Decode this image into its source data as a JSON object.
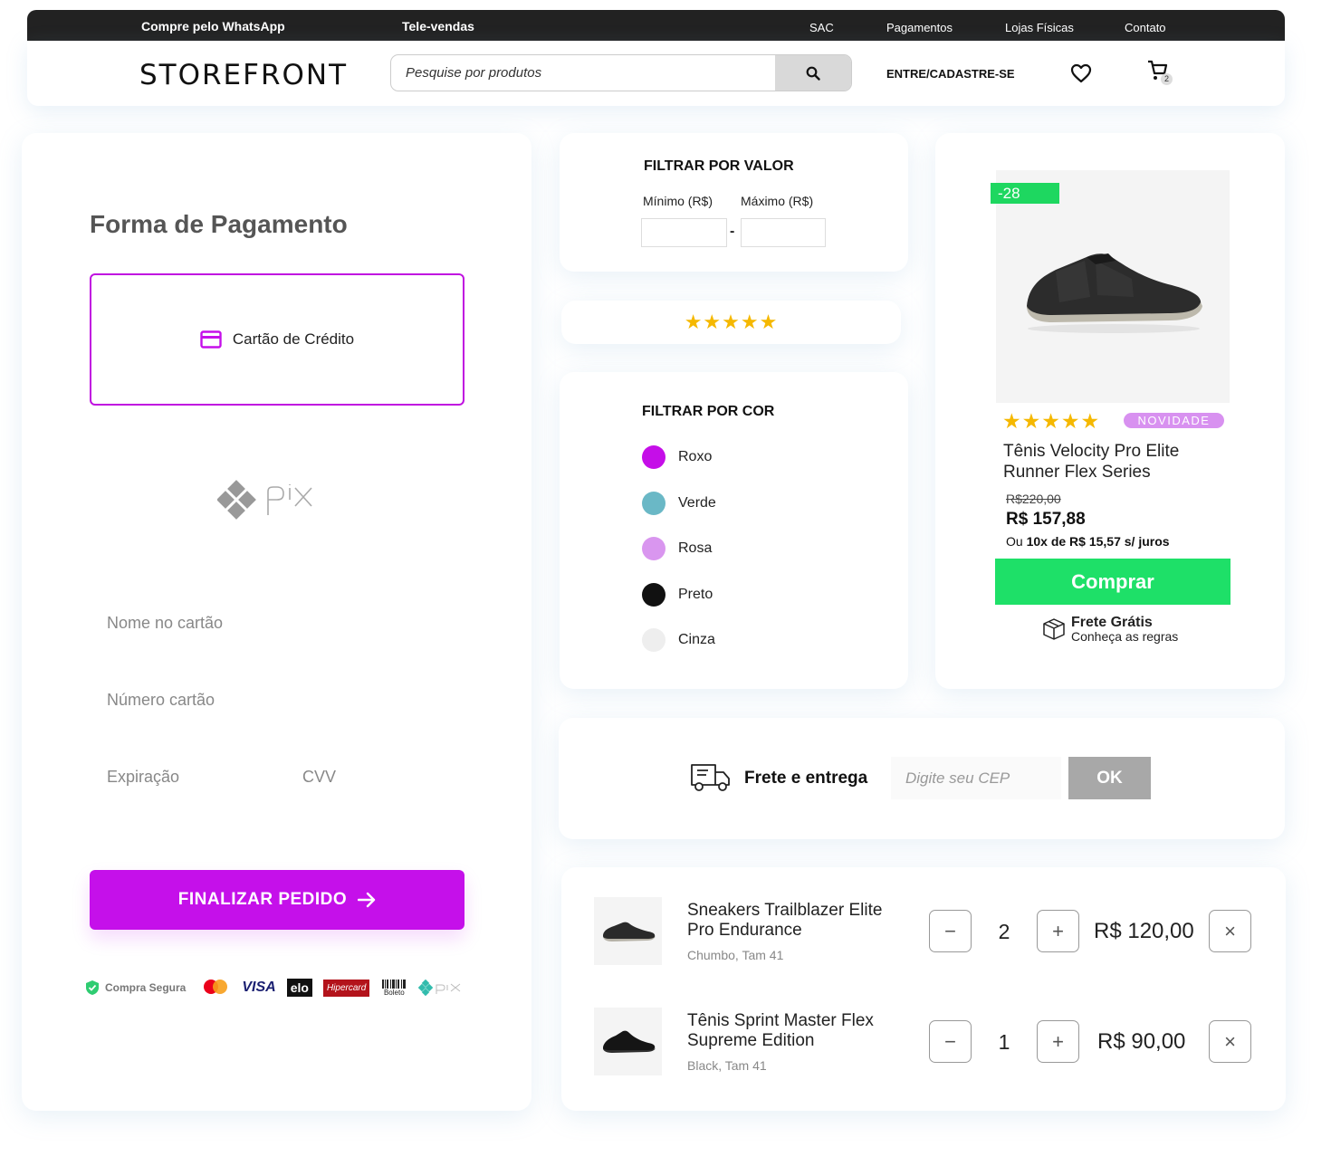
{
  "topbar": {
    "whatsapp": "Compre pelo WhatsApp",
    "televendas": "Tele-vendas",
    "links": [
      "SAC",
      "Pagamentos",
      "Lojas Físicas",
      "Contato"
    ]
  },
  "header": {
    "logo": "STOREFRONT",
    "search_placeholder": "Pesquise por produtos",
    "login": "ENTRE/CADASTRE-SE",
    "cart_count": "2"
  },
  "payment": {
    "title": "Forma de Pagamento",
    "credit_option": "Cartão de Crédito",
    "pix_label": "pix",
    "fields": {
      "name": "Nome no cartão",
      "number": "Número cartão",
      "expiry": "Expiração",
      "cvv": "CVV"
    },
    "finish": "FINALIZAR PEDIDO",
    "secure": "Compra Segura",
    "logos": [
      "VISA",
      "elo",
      "Hipercard",
      "Boleto"
    ]
  },
  "filter_value": {
    "title": "FILTRAR POR VALOR",
    "min_label": "Mínimo (R$)",
    "max_label": "Máximo (R$)",
    "separator": "-"
  },
  "rating_filter": {
    "stars": "★★★★★"
  },
  "filter_color": {
    "title": "FILTRAR POR COR",
    "colors": [
      {
        "name": "Roxo",
        "hex": "#c50ee8"
      },
      {
        "name": "Verde",
        "hex": "#6ab8c6"
      },
      {
        "name": "Rosa",
        "hex": "#d996ef"
      },
      {
        "name": "Preto",
        "hex": "#111111"
      },
      {
        "name": "Cinza",
        "hex": "#eeeeee"
      }
    ]
  },
  "product": {
    "discount": "-28",
    "stars": "★★★★★",
    "badge": "NOVIDADE",
    "name": "Tênis Velocity Pro Elite Runner Flex Series",
    "old_price": "R$220,00",
    "price": "R$ 157,88",
    "install_prefix": "Ou ",
    "install_bold": "10x de R$ 15,57 s/ juros",
    "buy": "Comprar",
    "ship_free": "Frete Grátis",
    "ship_rules": "Conheça as regras"
  },
  "shipping": {
    "title": "Frete e entrega",
    "cep_placeholder": "Digite seu CEP",
    "ok": "OK"
  },
  "cart": {
    "items": [
      {
        "name": "Sneakers Trailblazer Elite Pro Endurance",
        "variant": "Chumbo, Tam 41",
        "qty": "2",
        "price": "R$ 120,00"
      },
      {
        "name": "Tênis Sprint Master Flex Supreme Edition",
        "variant": "Black, Tam 41",
        "qty": "1",
        "price": "R$ 90,00"
      }
    ],
    "minus": "−",
    "plus": "+",
    "remove": "×"
  },
  "colors": {
    "accent": "#c510ea",
    "buy_green": "#1ee068",
    "star": "#f5b800"
  }
}
